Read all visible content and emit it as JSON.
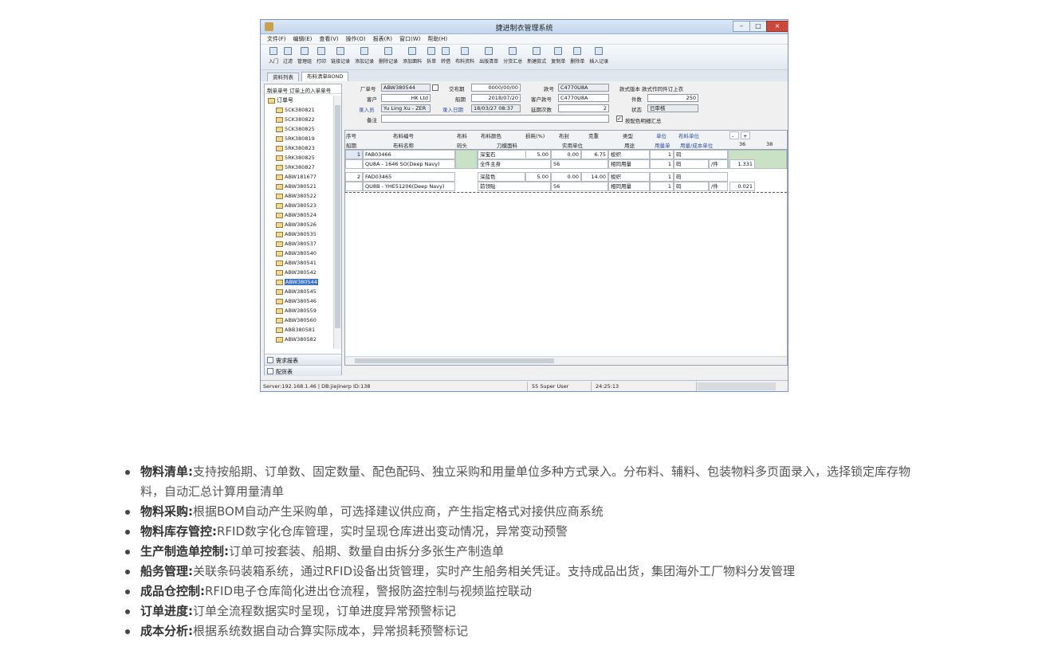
{
  "window": {
    "title": "捷进制衣管理系统"
  },
  "menu": [
    "文件(F)",
    "编辑(E)",
    "查看(V)",
    "操作(O)",
    "报表(R)",
    "窗口(W)",
    "帮助(H)"
  ],
  "toolbar": [
    "入门",
    "过滤",
    "管理组",
    "打印",
    "链接记录",
    "添加记录",
    "删除记录",
    "添加面料",
    "拆单",
    "转借",
    "布料资料",
    "出版清单",
    "分货汇总",
    "新建款式",
    "复制单",
    "删除单",
    "插入记录"
  ],
  "tabs": [
    "资料列表",
    "布料清单BOND"
  ],
  "left_panel": {
    "header": "制单单号 订单上的入单单号",
    "root": "订单号",
    "items": [
      "5CK380821",
      "5CK380822",
      "5CK380825",
      "5RK380819",
      "5RK380823",
      "5RK380825",
      "5RK380827",
      "ABW181677",
      "ABW380521",
      "ABW380522",
      "ABW380523",
      "ABW380524",
      "ABW380526",
      "ABW380535",
      "ABW380537",
      "ABW380540",
      "ABW380541",
      "ABW380542",
      "ABW380544",
      "ABW380545",
      "ABW380546",
      "ABW380559",
      "ABW380560",
      "ABB380581",
      "ABW380582"
    ],
    "selected": "ABW380544",
    "footer_items": [
      "需求报表",
      "配货表"
    ]
  },
  "form": {
    "labels": {
      "factory_no": "厂单号",
      "due_date": "交布期",
      "style_no": "款号",
      "merge": "款式版本 款式作同件订上衣",
      "customer": "客户",
      "ship_date": "船期",
      "customer_style": "客户款号",
      "qty": "件数",
      "entered_by": "录入员",
      "entered_date": "录入日期",
      "confirm_count": "延期次数",
      "status": "状态",
      "remark": "备注",
      "auto_check": "按配色明细汇总"
    },
    "values": {
      "factory_no": "ABW380544",
      "due_date": "0000/00/00",
      "style_no": "C4770U8A",
      "customer": "HK Ltd",
      "ship_date": "2018/07/20",
      "customer_style": "C4770U8A",
      "qty": "250",
      "entered_by": "Yu Ling Xu - ZER",
      "entered_date": "18/03/27 08:37",
      "confirm_count": "2",
      "status": "已审核"
    }
  },
  "grid": {
    "headers_row1": [
      "序号",
      "布料编号",
      "布料",
      "布料颜色",
      "损耗(%)",
      "布封",
      "克重",
      "类型",
      "单位",
      "布料单位",
      "36",
      "38"
    ],
    "headers_row2": [
      "船期",
      "布料名称",
      "码头",
      "刀模面料",
      "实用单位",
      "用途",
      "用量单",
      "用量/成本单位"
    ],
    "rows": [
      {
        "seq": "1",
        "code": "FAB03466",
        "name": "QU8A - 1646 SO(Deep Navy)",
        "color": "深宝石",
        "usage": "全件主身",
        "loss": "5.00",
        "width": "0.00",
        "weight": "6.75",
        "width2": "56",
        "type": "梭织",
        "use": "相同用量",
        "unit_qty1": "1",
        "unit_qty2": "1",
        "unit": "码",
        "per": "/件",
        "amount": "1.331"
      },
      {
        "seq": "2",
        "code": "FAD03465",
        "name": "QU8B - YHE51206(Deep Navy)",
        "color": "深蓝色",
        "usage": "前领贴",
        "loss": "5.00",
        "width": "0.00",
        "weight": "14.00",
        "width2": "56",
        "type": "梭织",
        "use": "相同用量",
        "unit_qty1": "1",
        "unit_qty2": "1",
        "unit": "码",
        "per": "/件",
        "amount": "0.021"
      }
    ]
  },
  "status": {
    "server": "Server:192.168.1.46 | DB:jiejinerp ID:138",
    "user": "55 Super User",
    "time": "24:25:13"
  },
  "features": [
    {
      "title": "物料清单:",
      "text": "支持按船期、订单数、固定数量、配色配码、独立采购和用量单位多种方式录入。分布料、辅料、包装物料多页面录入，选择锁定库存物料，自动汇总计算用量清单"
    },
    {
      "title": "物料采购:",
      "text": "根据BOM自动产生采购单，可选择建议供应商，产生指定格式对接供应商系统"
    },
    {
      "title": "物料库存管控:",
      "text": "RFID数字化仓库管理，实时呈现仓库进出变动情况，异常变动预警"
    },
    {
      "title": "生产制造单控制:",
      "text": "订单可按套装、船期、数量自由拆分多张生产制造单"
    },
    {
      "title": "船务管理:",
      "text": "关联条码装箱系统，通过RFID设备出货管理，实时产生船务相关凭证。支持成品出货，集团海外工厂物料分发管理"
    },
    {
      "title": "成品仓控制:",
      "text": "RFID电子仓库简化进出仓流程，警报防盗控制与视频监控联动"
    },
    {
      "title": "订单进度:",
      "text": "订单全流程数据实时呈现，订单进度异常预警标记"
    },
    {
      "title": "成本分析:",
      "text": "根据系统数据自动合算实际成本，异常损耗预警标记"
    }
  ]
}
